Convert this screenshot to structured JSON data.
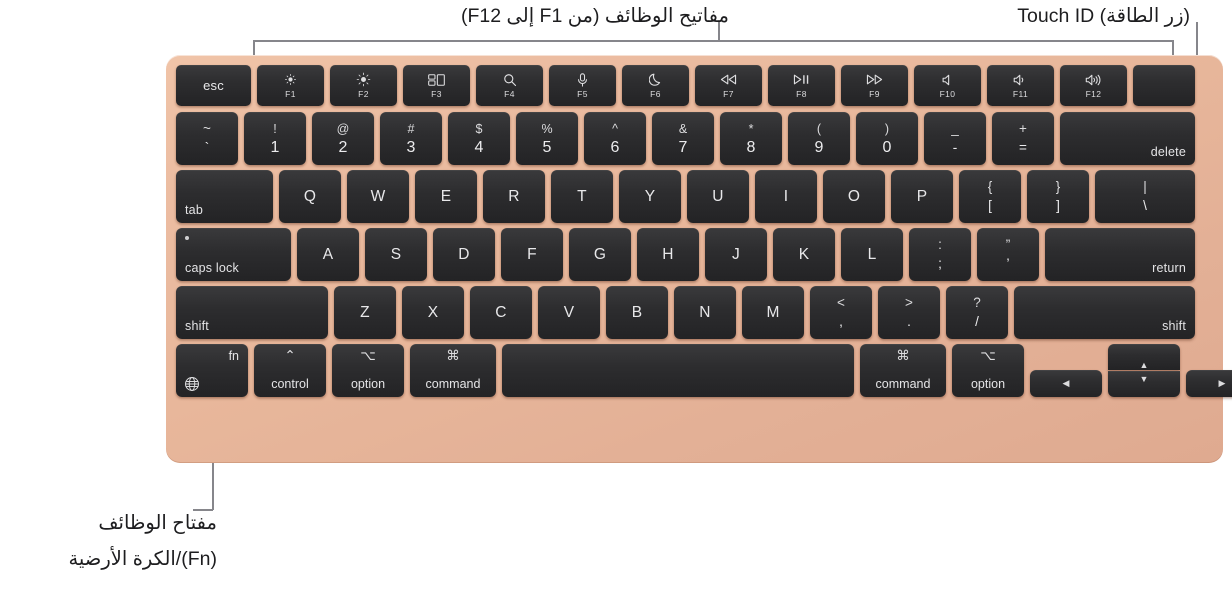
{
  "annotations": {
    "function_keys": "مفاتيح الوظائف (من F1 إلى F12)",
    "touch_id": "Touch ID (زر الطاقة)",
    "fn_key_line1": "مفتاح الوظائف",
    "fn_key_line2": "(Fn)/الكرة الأرضية"
  },
  "colors": {
    "body": "#e8b79b",
    "key": "#2d2d2f",
    "key_text": "#e8e8ea",
    "leader": "#86868b",
    "page_background": "#ffffff"
  },
  "keyboard": {
    "layout": "US ANSI MacBook Air Magic Keyboard",
    "function_row": [
      {
        "label": "esc",
        "icon": "",
        "fkey": ""
      },
      {
        "label": "",
        "icon": "brightness-down-icon",
        "fkey": "F1"
      },
      {
        "label": "",
        "icon": "brightness-up-icon",
        "fkey": "F2"
      },
      {
        "label": "",
        "icon": "mission-control-icon",
        "fkey": "F3"
      },
      {
        "label": "",
        "icon": "spotlight-search-icon",
        "fkey": "F4"
      },
      {
        "label": "",
        "icon": "dictation-microphone-icon",
        "fkey": "F5"
      },
      {
        "label": "",
        "icon": "do-not-disturb-moon-icon",
        "fkey": "F6"
      },
      {
        "label": "",
        "icon": "rewind-icon",
        "fkey": "F7"
      },
      {
        "label": "",
        "icon": "play-pause-icon",
        "fkey": "F8"
      },
      {
        "label": "",
        "icon": "fast-forward-icon",
        "fkey": "F9"
      },
      {
        "label": "",
        "icon": "mute-icon",
        "fkey": "F10"
      },
      {
        "label": "",
        "icon": "volume-down-icon",
        "fkey": "F11"
      },
      {
        "label": "",
        "icon": "volume-up-icon",
        "fkey": "F12"
      },
      {
        "label": "",
        "icon": "touch-id-icon",
        "fkey": ""
      }
    ],
    "number_row": [
      {
        "upper": "~",
        "lower": "`"
      },
      {
        "upper": "!",
        "lower": "1"
      },
      {
        "upper": "@",
        "lower": "2"
      },
      {
        "upper": "#",
        "lower": "3"
      },
      {
        "upper": "$",
        "lower": "4"
      },
      {
        "upper": "%",
        "lower": "5"
      },
      {
        "upper": "^",
        "lower": "6"
      },
      {
        "upper": "&",
        "lower": "7"
      },
      {
        "upper": "*",
        "lower": "8"
      },
      {
        "upper": "(",
        "lower": "9"
      },
      {
        "upper": ")",
        "lower": "0"
      },
      {
        "upper": "_",
        "lower": "-"
      },
      {
        "upper": "+",
        "lower": "="
      },
      {
        "label": "delete"
      }
    ],
    "tab_row": [
      {
        "label": "tab"
      },
      {
        "label": "Q"
      },
      {
        "label": "W"
      },
      {
        "label": "E"
      },
      {
        "label": "R"
      },
      {
        "label": "T"
      },
      {
        "label": "Y"
      },
      {
        "label": "U"
      },
      {
        "label": "I"
      },
      {
        "label": "O"
      },
      {
        "label": "P"
      },
      {
        "upper": "{",
        "lower": "["
      },
      {
        "upper": "}",
        "lower": "]"
      },
      {
        "upper": "|",
        "lower": "\\"
      }
    ],
    "home_row": [
      {
        "label": "caps lock"
      },
      {
        "label": "A"
      },
      {
        "label": "S"
      },
      {
        "label": "D"
      },
      {
        "label": "F"
      },
      {
        "label": "G"
      },
      {
        "label": "H"
      },
      {
        "label": "J"
      },
      {
        "label": "K"
      },
      {
        "label": "L"
      },
      {
        "upper": ":",
        "lower": ";"
      },
      {
        "upper": "”",
        "lower": "’"
      },
      {
        "label": "return"
      }
    ],
    "shift_row": [
      {
        "label": "shift"
      },
      {
        "label": "Z"
      },
      {
        "label": "X"
      },
      {
        "label": "C"
      },
      {
        "label": "V"
      },
      {
        "label": "B"
      },
      {
        "label": "N"
      },
      {
        "label": "M"
      },
      {
        "upper": "<",
        "lower": ","
      },
      {
        "upper": ">",
        "lower": "."
      },
      {
        "upper": "?",
        "lower": "/"
      },
      {
        "label": "shift"
      }
    ],
    "bottom_row": [
      {
        "label": "fn",
        "icon": "globe-icon"
      },
      {
        "label": "control",
        "glyph": "⌃"
      },
      {
        "label": "option",
        "glyph": "⌥"
      },
      {
        "label": "command",
        "glyph": "⌘"
      },
      {
        "label": "space"
      },
      {
        "label": "command",
        "glyph": "⌘"
      },
      {
        "label": "option",
        "glyph": "⌥"
      },
      {
        "label": "left-arrow",
        "glyph": "◀"
      },
      {
        "label": "up-arrow",
        "glyph": "▲"
      },
      {
        "label": "down-arrow",
        "glyph": "▼"
      },
      {
        "label": "right-arrow",
        "glyph": "▶"
      }
    ]
  }
}
